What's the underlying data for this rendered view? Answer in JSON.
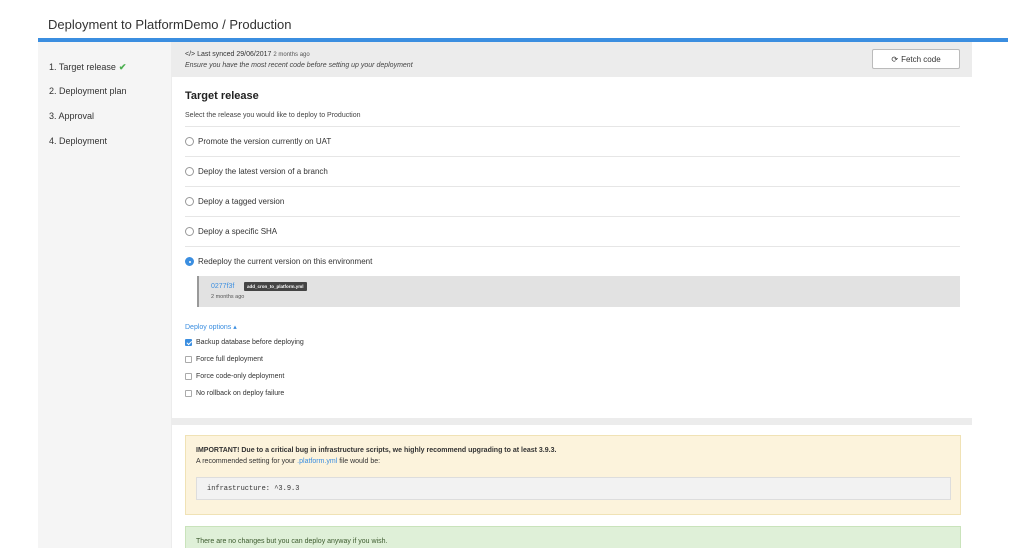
{
  "header": {
    "title": "Deployment to PlatformDemo / Production"
  },
  "colors": {
    "accent": "#3b8ee0",
    "success": "#4caf50",
    "warning_bg": "#fcf3dc",
    "ok_bg": "#dff0d8"
  },
  "sidebar": {
    "steps": [
      {
        "label": "1. Target release",
        "completed": true
      },
      {
        "label": "2. Deployment plan",
        "completed": false
      },
      {
        "label": "3. Approval",
        "completed": false
      },
      {
        "label": "4. Deployment",
        "completed": false
      }
    ],
    "check_icon": "✔"
  },
  "sync": {
    "code_icon": "</>",
    "text": "Last synced 29/06/2017",
    "ago": "2 months ago",
    "hint": "Ensure you have the most recent code before setting up your deployment",
    "fetch_icon": "⟳",
    "fetch_label": "Fetch code"
  },
  "target": {
    "title": "Target release",
    "subtitle": "Select the release you would like to deploy to Production",
    "options": [
      {
        "label": "Promote the version currently on UAT",
        "selected": false
      },
      {
        "label": "Deploy the latest version of a branch",
        "selected": false
      },
      {
        "label": "Deploy a tagged version",
        "selected": false
      },
      {
        "label": "Deploy a specific SHA",
        "selected": false
      },
      {
        "label": "Redeploy the current version on this environment",
        "selected": true
      }
    ],
    "commit": {
      "sha": "0277f3f",
      "tag": "add_cron_to_platform.yml",
      "time": "2 months ago"
    }
  },
  "deploy_options": {
    "toggle_label": "Deploy options ▴",
    "items": [
      {
        "label": "Backup database before deploying",
        "checked": true
      },
      {
        "label": "Force full deployment",
        "checked": false
      },
      {
        "label": "Force code-only deployment",
        "checked": false
      },
      {
        "label": "No rollback on deploy failure",
        "checked": false
      }
    ]
  },
  "notice": {
    "title": "IMPORTANT! Due to a critical bug in infrastructure scripts, we highly recommend upgrading to at least 3.9.3.",
    "sub_prefix": "A recommended setting for your",
    "sub_file": ".platform.yml",
    "sub_suffix": "file would be:",
    "code": "infrastructure: ^3.9.3"
  },
  "status": {
    "text": "There are no changes but you can deploy anyway if you wish."
  }
}
